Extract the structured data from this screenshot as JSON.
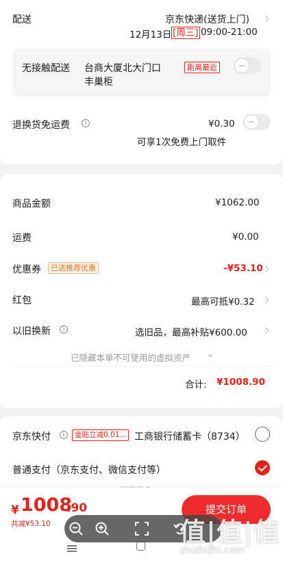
{
  "delivery": {
    "label": "配送",
    "method": "京东快递(送货上门)",
    "date": "12月13日",
    "weekday": "[周三]",
    "time": "09:00-21:00",
    "contactless_label": "无接触配送",
    "locker_line1": "台商大厦北大门口",
    "locker_line2": "丰巢柜",
    "nearest_tag": "距离最近"
  },
  "return_shipping": {
    "label": "退换货免运费",
    "info_icon": "i",
    "price": "¥0.30",
    "desc": "可享1次免费上门取件"
  },
  "summary": {
    "goods_label": "商品金额",
    "goods_value": "¥1062.00",
    "freight_label": "运费",
    "freight_value": "¥0.00",
    "coupon_label": "优惠券",
    "coupon_tag": "已选推荐优惠",
    "coupon_value": "-¥53.10",
    "redpacket_label": "红包",
    "redpacket_value": "最高可抵¥0.32",
    "tradein_label": "以旧换新",
    "tradein_value": "选旧品，最高补贴¥600.00",
    "hidden_assets": "已隐藏本单不可使用的虚拟资产",
    "total_label": "合计:",
    "total_value": "¥1008.90"
  },
  "payment": {
    "jd_fast_label": "京东快付",
    "jd_fast_tag": "金贴立减0.01...",
    "bank_card": "工商银行储蓄卡（8734）",
    "normal_label": "普通支付（京东支付、微信支付等）",
    "more_partial": "展开更多"
  },
  "bottom": {
    "currency": "¥",
    "price_int": "1008",
    "price_dec": ".90",
    "saved": "共减¥53.10",
    "submit": "提交订单"
  },
  "viewer_icons": [
    "zoom-out-icon",
    "zoom-in-icon",
    "fullscreen-icon",
    "rotate-icon"
  ],
  "watermark": {
    "text": "值|值|值",
    "url": "zhizhizhi.com"
  },
  "colors": {
    "accent": "#e2231a",
    "submit_bg": "#ee2c2c",
    "tag_orange": "#e0701b"
  }
}
